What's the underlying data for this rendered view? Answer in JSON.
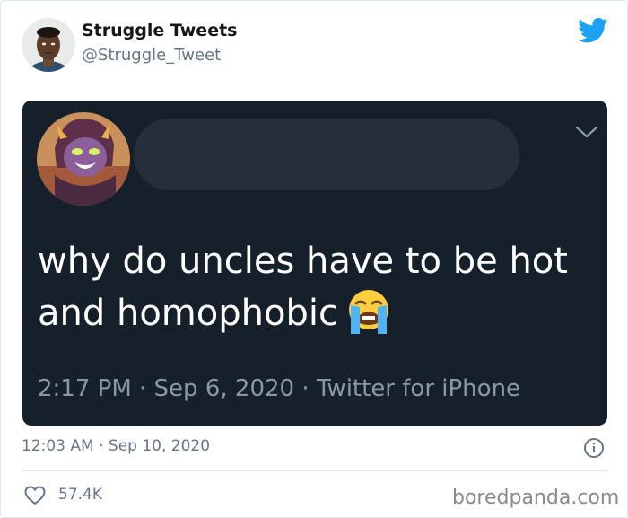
{
  "tweet": {
    "author_name": "Struggle Tweets",
    "author_handle": "@Struggle_Tweet",
    "timestamp": "12:03 AM · Sep 10, 2020",
    "likes": "57.4K",
    "embedded": {
      "text": "why do uncles have to be hot and homophobic",
      "emoji": "loudly-crying-face",
      "meta": "2:17 PM · Sep 6, 2020 · Twitter for iPhone"
    }
  },
  "watermark": "boredpanda.com",
  "colors": {
    "twitter_blue": "#1da1f2",
    "embed_bg": "#15202b",
    "muted_text": "#657786"
  },
  "icons": [
    "twitter-bird-icon",
    "chevron-down-icon",
    "info-icon",
    "heart-icon"
  ]
}
